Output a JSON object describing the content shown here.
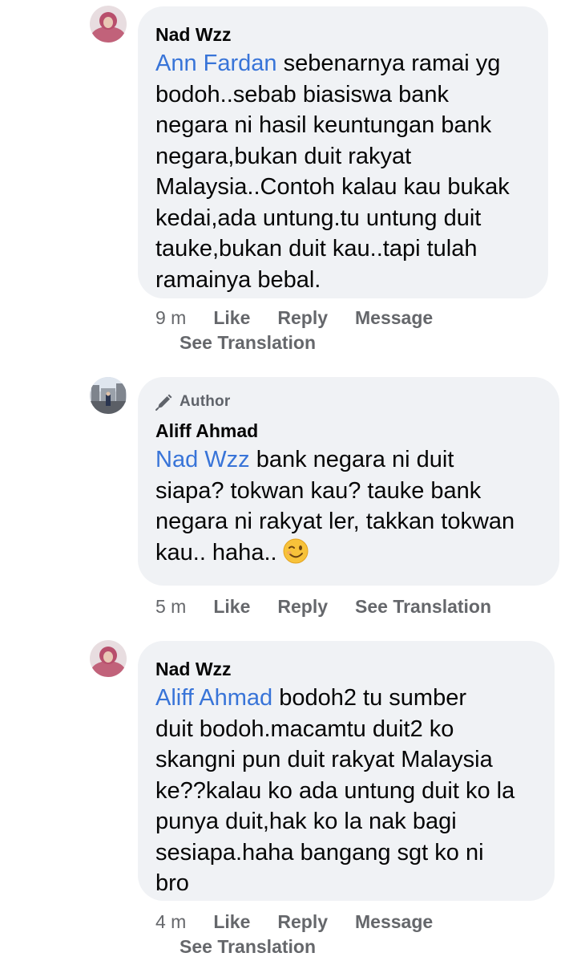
{
  "comments": [
    {
      "author": "Nad Wzz",
      "is_author": false,
      "mention": "Ann Fardan",
      "text_lines": [
        " sebenarnya ramai yg",
        "bodoh..sebab biasiswa bank",
        "negara ni hasil keuntungan bank",
        "negara,bukan duit rakyat",
        "Malaysia..Contoh kalau kau bukak",
        "kedai,ada untung.tu untung duit",
        "tauke,bukan duit kau..tapi tulah",
        "ramainya bebal."
      ],
      "time": "9 m",
      "like": "Like",
      "reply": "Reply",
      "message": "Message",
      "see_translation": "See Translation"
    },
    {
      "author": "Aliff Ahmad",
      "is_author": true,
      "author_badge": "Author",
      "author_badge_icon": "pen-icon",
      "mention": "Nad Wzz",
      "text_lines": [
        " bank negara ni duit",
        "siapa? tokwan kau? tauke bank",
        "negara ni rakyat ler, takkan tokwan",
        "kau.. haha.."
      ],
      "emoji": "winking-face-emoji",
      "time": "5 m",
      "like": "Like",
      "reply": "Reply",
      "see_translation": "See Translation"
    },
    {
      "author": "Nad Wzz",
      "is_author": false,
      "mention": "Aliff Ahmad",
      "text_lines": [
        " bodoh2 tu sumber",
        "duit bodoh.macamtu duit2 ko",
        "skangni pun duit rakyat Malaysia",
        "ke??kalau ko ada untung duit ko la",
        "punya duit,hak ko la nak bagi",
        "sesiapa.haha bangang sgt ko ni",
        "bro"
      ],
      "time": "4 m",
      "like": "Like",
      "reply": "Reply",
      "message": "Message",
      "see_translation": "See Translation"
    }
  ],
  "colors": {
    "bubble_bg": "#f0f2f5",
    "mention": "#3874d8",
    "meta_text": "#65676b",
    "body_text": "#050505"
  }
}
